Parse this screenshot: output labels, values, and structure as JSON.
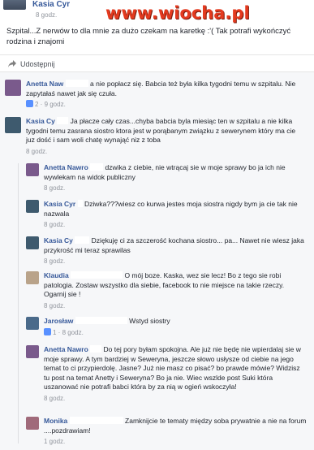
{
  "post": {
    "author": "Kasia Cyr",
    "time": "8 godz.",
    "watermark": "www.wiocha.pl",
    "text": "Szpital...Z nerwów to dla mnie za dużo czekam na karetkę :'( Tak potrafi wykończyć rodzina i znajomi"
  },
  "share": {
    "label": "Udostępnij",
    "icon": "share-icon"
  },
  "comments": [
    {
      "name": "Anetta Naw",
      "text": "a nie popłacz się. Babcia też była kilka tygodni temu w szpitalu. Nie zapytałaś nawet jak się czuła.",
      "likes": "2",
      "time": "9 godz.",
      "avatar_color": "#7a5a8c"
    },
    {
      "name": "Kasia Cy",
      "text": "Ja płacze cały czas...chyba babcia byla miesiąc ten w szpitalu a nie kilka tygodni temu zasrana siostro ktora jest w porąbanym związku z seweryn​em który ma cie juz dość i sam woli chatę wynająć niz z toba",
      "time": "8 godz.",
      "avatar_color": "#3e5a6e"
    },
    {
      "name": "Anetta Nawro",
      "text": "dzwika z ciebie, nie wtrącaj sie w moje sprawy bo ja ich nie wywlekam na widok publiczny",
      "time": "8 godz.",
      "avatar_color": "#7a5a8c"
    },
    {
      "name": "Kasia Cyr",
      "text": "Dziwka???wiesz co kurwa jestes moja siostra nigdy bym ja cie tak nie nazwala",
      "time": "8 godz.",
      "avatar_color": "#3e5a6e"
    },
    {
      "name": "Kasia Cy",
      "text": "Dziękuję ci za szczerość kochana siostro... pa... Nawet nie wiesz jaka przykrość mi teraz sprawilas",
      "time": "8 godz.",
      "avatar_color": "#3e5a6e"
    },
    {
      "name": "Klaudia",
      "text": "O mój boze. Kaska, wez sie lecz! Bo z tego sie robi patologia. Zostaw wszystko dla siebie, facebook to nie miejsce na takie rzeczy. Ogarnij sie !",
      "time": "8 godz.",
      "avatar_color": "#b9a38a"
    },
    {
      "name": "Jarosław",
      "text": "Wstyd siostry",
      "likes": "1",
      "time": "8 godz.",
      "avatar_color": "#4a6a8a"
    },
    {
      "name": "Anetta Nawro",
      "text": "Do tej pory byłam spokojna. Ale już nie będę nie wpierdalaj sie w moje sprawy. A tym bardziej w Seweryna, jeszcze słowo usłysze od ciebie na jego temat to ci przypierdolę. Jasne? Już nie masz co pisać? bo prawde mówie? Widzisz tu post na temat Anetty i Seweryna? Bo ja nie. Wiec wszlde post Suki która uszanować nie potrafi babci która by za nią w ogień wskoczyła!",
      "time": "8 godz.",
      "avatar_color": "#7a5a8c"
    },
    {
      "name": "Monika",
      "text": "Zamknijcie te tematy między soba prywatnie a nie na forum ....pozdrawiam!",
      "time": "1 godz.",
      "avatar_color": "#a06a7a"
    }
  ]
}
